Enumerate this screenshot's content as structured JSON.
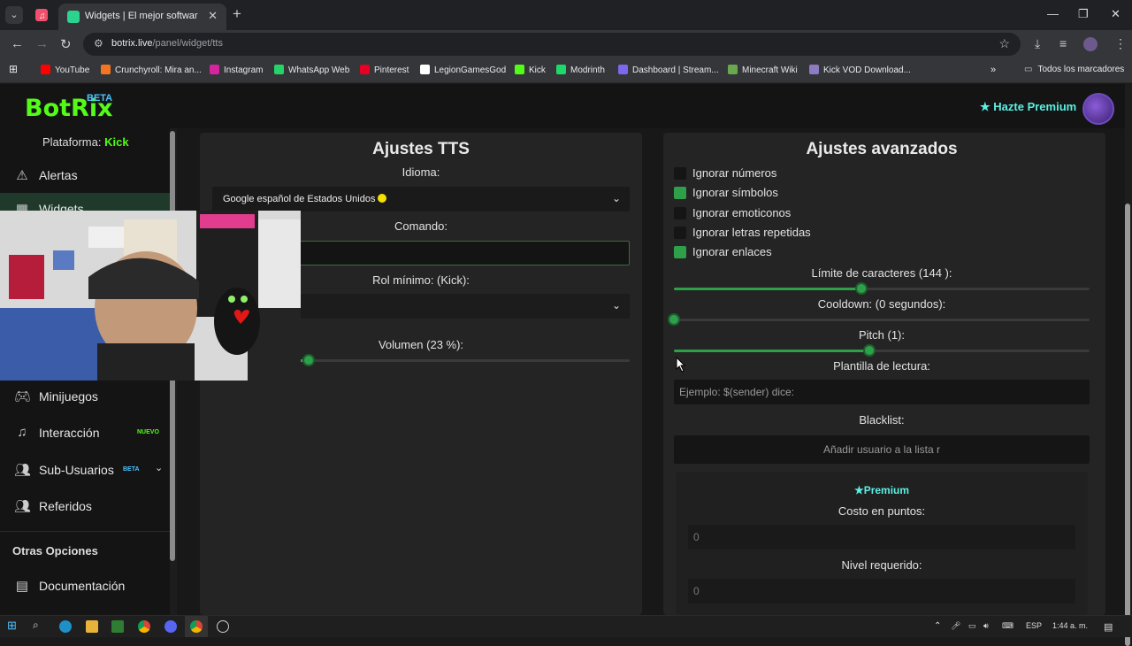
{
  "browser": {
    "tab_title": "Widgets | El mejor software par",
    "url_host": "botrix.live",
    "url_path": "/panel/widget/tts",
    "bookmarks": [
      {
        "label": "YouTube",
        "color": "#ff0000"
      },
      {
        "label": "Crunchyroll: Mira an...",
        "color": "#f47521"
      },
      {
        "label": "Instagram",
        "color": "#d6249f"
      },
      {
        "label": "WhatsApp Web",
        "color": "#25d366"
      },
      {
        "label": "Pinterest",
        "color": "#e60023"
      },
      {
        "label": "LegionGamesGod",
        "color": "#ffffff"
      },
      {
        "label": "Kick",
        "color": "#53fc18"
      },
      {
        "label": "Modrinth",
        "color": "#1bd96a"
      },
      {
        "label": "Dashboard | Stream...",
        "color": "#7b68ee"
      },
      {
        "label": "Minecraft Wiki",
        "color": "#6aa84f"
      },
      {
        "label": "Kick VOD Download...",
        "color": "#8e7cc3"
      }
    ],
    "all_bookmarks": "Todos los marcadores"
  },
  "header": {
    "logo": "BotRix",
    "beta": "BETA",
    "premium_link": "Hazte Premium"
  },
  "sidebar": {
    "platform_label": "Plataforma: ",
    "platform_value": "Kick",
    "items": [
      {
        "label": "Alertas",
        "icon": "warning-icon"
      },
      {
        "label": "Widgets",
        "icon": "widgets-icon"
      },
      {
        "label": "Minijuegos",
        "icon": "gamepad-icon"
      },
      {
        "label": "Interacción",
        "icon": "music-note-icon",
        "badge": "NUEVO"
      },
      {
        "label": "Sub-Usuarios",
        "icon": "users-icon",
        "badge": "BETA"
      },
      {
        "label": "Referidos",
        "icon": "user-group-icon"
      }
    ],
    "other_title": "Otras Opciones",
    "doc_label": "Documentación"
  },
  "tts": {
    "title": "Ajustes TTS",
    "language_label": "Idioma:",
    "language_value": "Google español de Estados Unidos",
    "command_label": "Comando:",
    "role_label": "Rol mínimo: (Kick):",
    "volume_label": "Volumen (23 %):",
    "volume_value": 23
  },
  "advanced": {
    "title": "Ajustes avanzados",
    "options": [
      {
        "label": "Ignorar números",
        "checked": false
      },
      {
        "label": "Ignorar símbolos",
        "checked": true
      },
      {
        "label": "Ignorar emoticonos",
        "checked": false
      },
      {
        "label": "Ignorar letras repetidas",
        "checked": false
      },
      {
        "label": "Ignorar enlaces",
        "checked": true
      }
    ],
    "char_limit_label": "Límite de caracteres (144 ):",
    "char_limit_fraction": 0.45,
    "cooldown_label": "Cooldown: (0 segundos):",
    "cooldown_fraction": 0,
    "pitch_label": "Pitch (1):",
    "pitch_fraction": 0.47,
    "template_label": "Plantilla de lectura:",
    "template_placeholder": "Ejemplo: $(sender) dice:",
    "blacklist_label": "Blacklist:",
    "blacklist_placeholder": "Añadir usuario a la lista r",
    "premium_title": "Premium",
    "cost_label": "Costo en puntos:",
    "cost_value": "0",
    "level_label": "Nivel requerido:",
    "level_value": "0"
  },
  "taskbar": {
    "lang": "ESP",
    "time": "1:44 a. m."
  }
}
